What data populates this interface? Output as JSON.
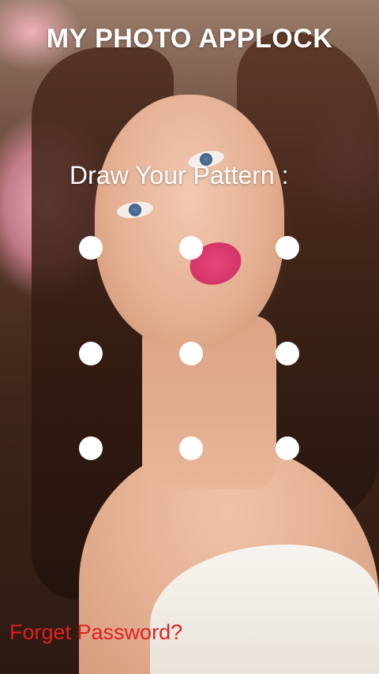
{
  "app": {
    "title": "MY PHOTO APPLOCK"
  },
  "lock": {
    "prompt": "Draw Your Pattern :",
    "grid_rows": 3,
    "grid_cols": 3
  },
  "actions": {
    "forgot_label": "Forget Password?"
  },
  "colors": {
    "title_text": "#ffffff",
    "prompt_text": "#ffffff",
    "dot": "#ffffff",
    "forgot_text": "#e02020"
  }
}
